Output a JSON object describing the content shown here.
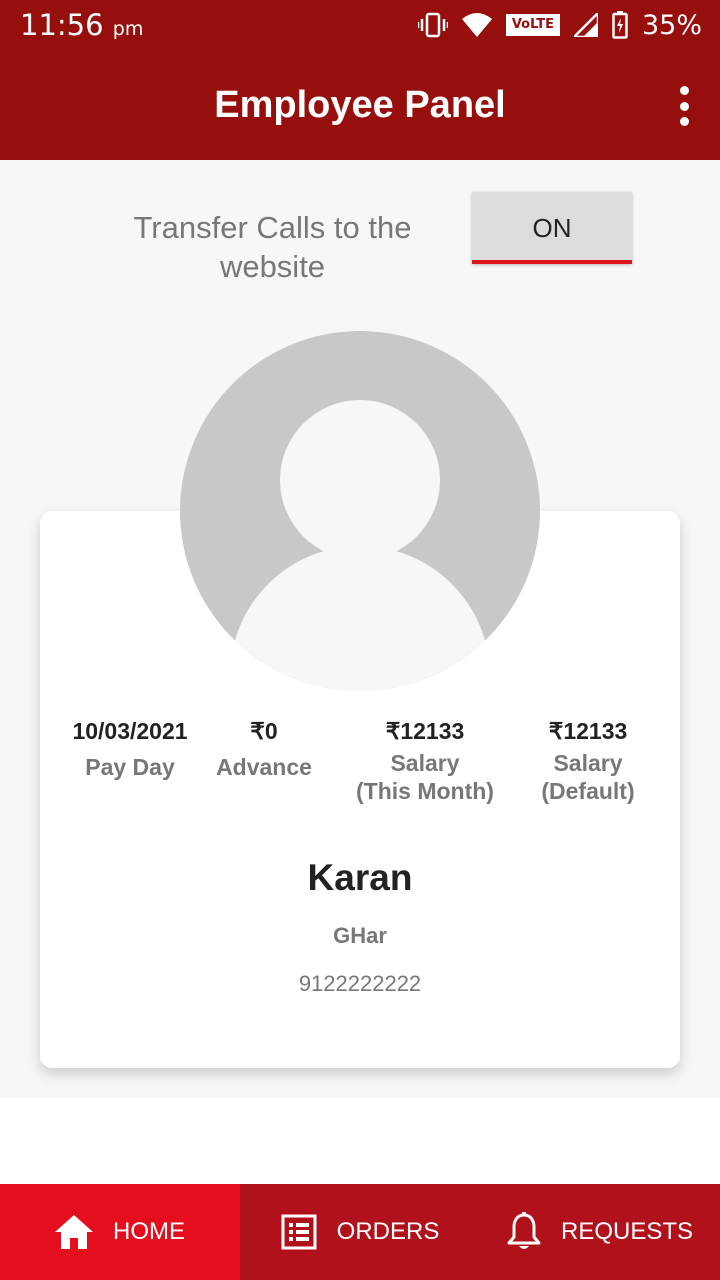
{
  "status_bar": {
    "time": "11:56",
    "ampm": "pm",
    "network_badge": "VoLTE",
    "battery": "35%",
    "icons": [
      "vibrate-icon",
      "wifi-icon",
      "signal-icon",
      "battery-icon"
    ]
  },
  "app_bar": {
    "title": "Employee Panel",
    "menu_icon": "more-vert-icon"
  },
  "transfer": {
    "label": "Transfer Calls to the website",
    "toggle_label": "ON"
  },
  "profile": {
    "avatar_icon": "person-placeholder-icon",
    "stats": [
      {
        "value": "10/03/2021",
        "label": "Pay Day"
      },
      {
        "value": "₹0",
        "label": "Advance"
      },
      {
        "value": "₹12133",
        "label": "Salary\n(This Month)"
      },
      {
        "value": "₹12133",
        "label": "Salary\n(Default)"
      }
    ],
    "name": "Karan",
    "location": "GHar",
    "phone": "9122222222"
  },
  "bottom_nav": [
    {
      "label": "HOME",
      "icon": "home-icon",
      "active": true
    },
    {
      "label": "ORDERS",
      "icon": "list-icon",
      "active": false
    },
    {
      "label": "REQUESTS",
      "icon": "bell-icon",
      "active": false
    }
  ],
  "colors": {
    "primary_dark": "#960f0d",
    "accent": "#e50e1e",
    "nav_bg": "#b1111b"
  }
}
